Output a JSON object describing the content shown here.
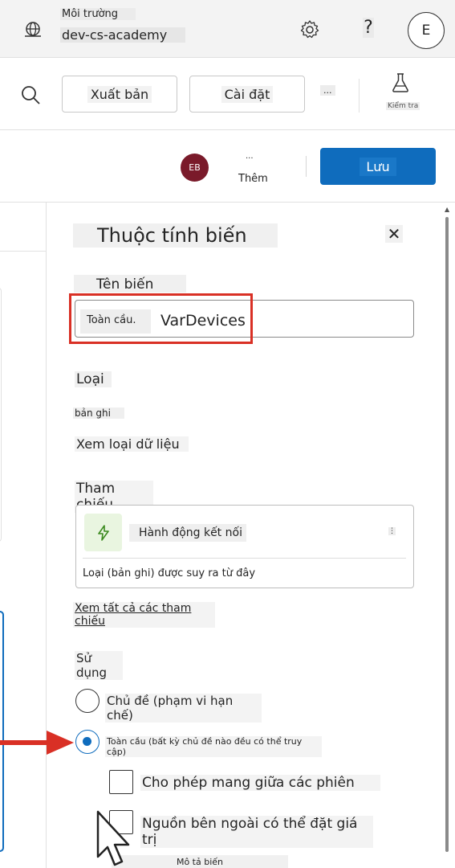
{
  "header": {
    "environment_label": "Môi trường",
    "environment_value": "dev-cs-academy",
    "help_label": "?",
    "user_initial": "E",
    "icons": [
      "globe-icon",
      "gear-icon"
    ]
  },
  "command_bar": {
    "publish_label": "Xuất bản",
    "settings_label": "Cài đặt",
    "more_label": "...",
    "test_label": "Kiểm tra",
    "icons": [
      "search-icon",
      "flask-icon"
    ]
  },
  "save_bar": {
    "avatar_initials": "EB",
    "more_dots": "...",
    "more_label": "Thêm",
    "save_label": "Lưu"
  },
  "panel": {
    "title": "Thuộc tính biến",
    "close_label": "✕",
    "name": {
      "label": "Tên biến",
      "prefix": "Toàn cầu.",
      "value": "VarDevices"
    },
    "type": {
      "label": "Loại",
      "value": "bản ghi",
      "view_link": "Xem loại dữ liệu"
    },
    "reference": {
      "label": "Tham chiếu",
      "item_title": "Hành động kết nối",
      "item_more": "⋮",
      "note": "Loại (bản ghi) được suy ra từ đây",
      "see_all": "Xem tất cả các tham chiếu"
    },
    "usage": {
      "label": "Sử dụng",
      "options": [
        {
          "label": "Chủ đề (phạm vi hạn chế)",
          "selected": false
        },
        {
          "label": "Toàn cầu (bất kỳ chủ đề nào đều có thể truy cập)",
          "selected": true
        }
      ],
      "checkboxes": [
        {
          "label": "Cho phép mang giữa các phiên",
          "checked": false
        },
        {
          "label": "Nguồn bên ngoài có thể đặt giá trị",
          "checked": false
        }
      ],
      "description_label": "Mô tả biến"
    }
  },
  "colors": {
    "accent": "#0f6cbd",
    "highlight": "#d93025",
    "avatar": "#7a1a2a",
    "bolt_bg": "#e9f5e0"
  }
}
